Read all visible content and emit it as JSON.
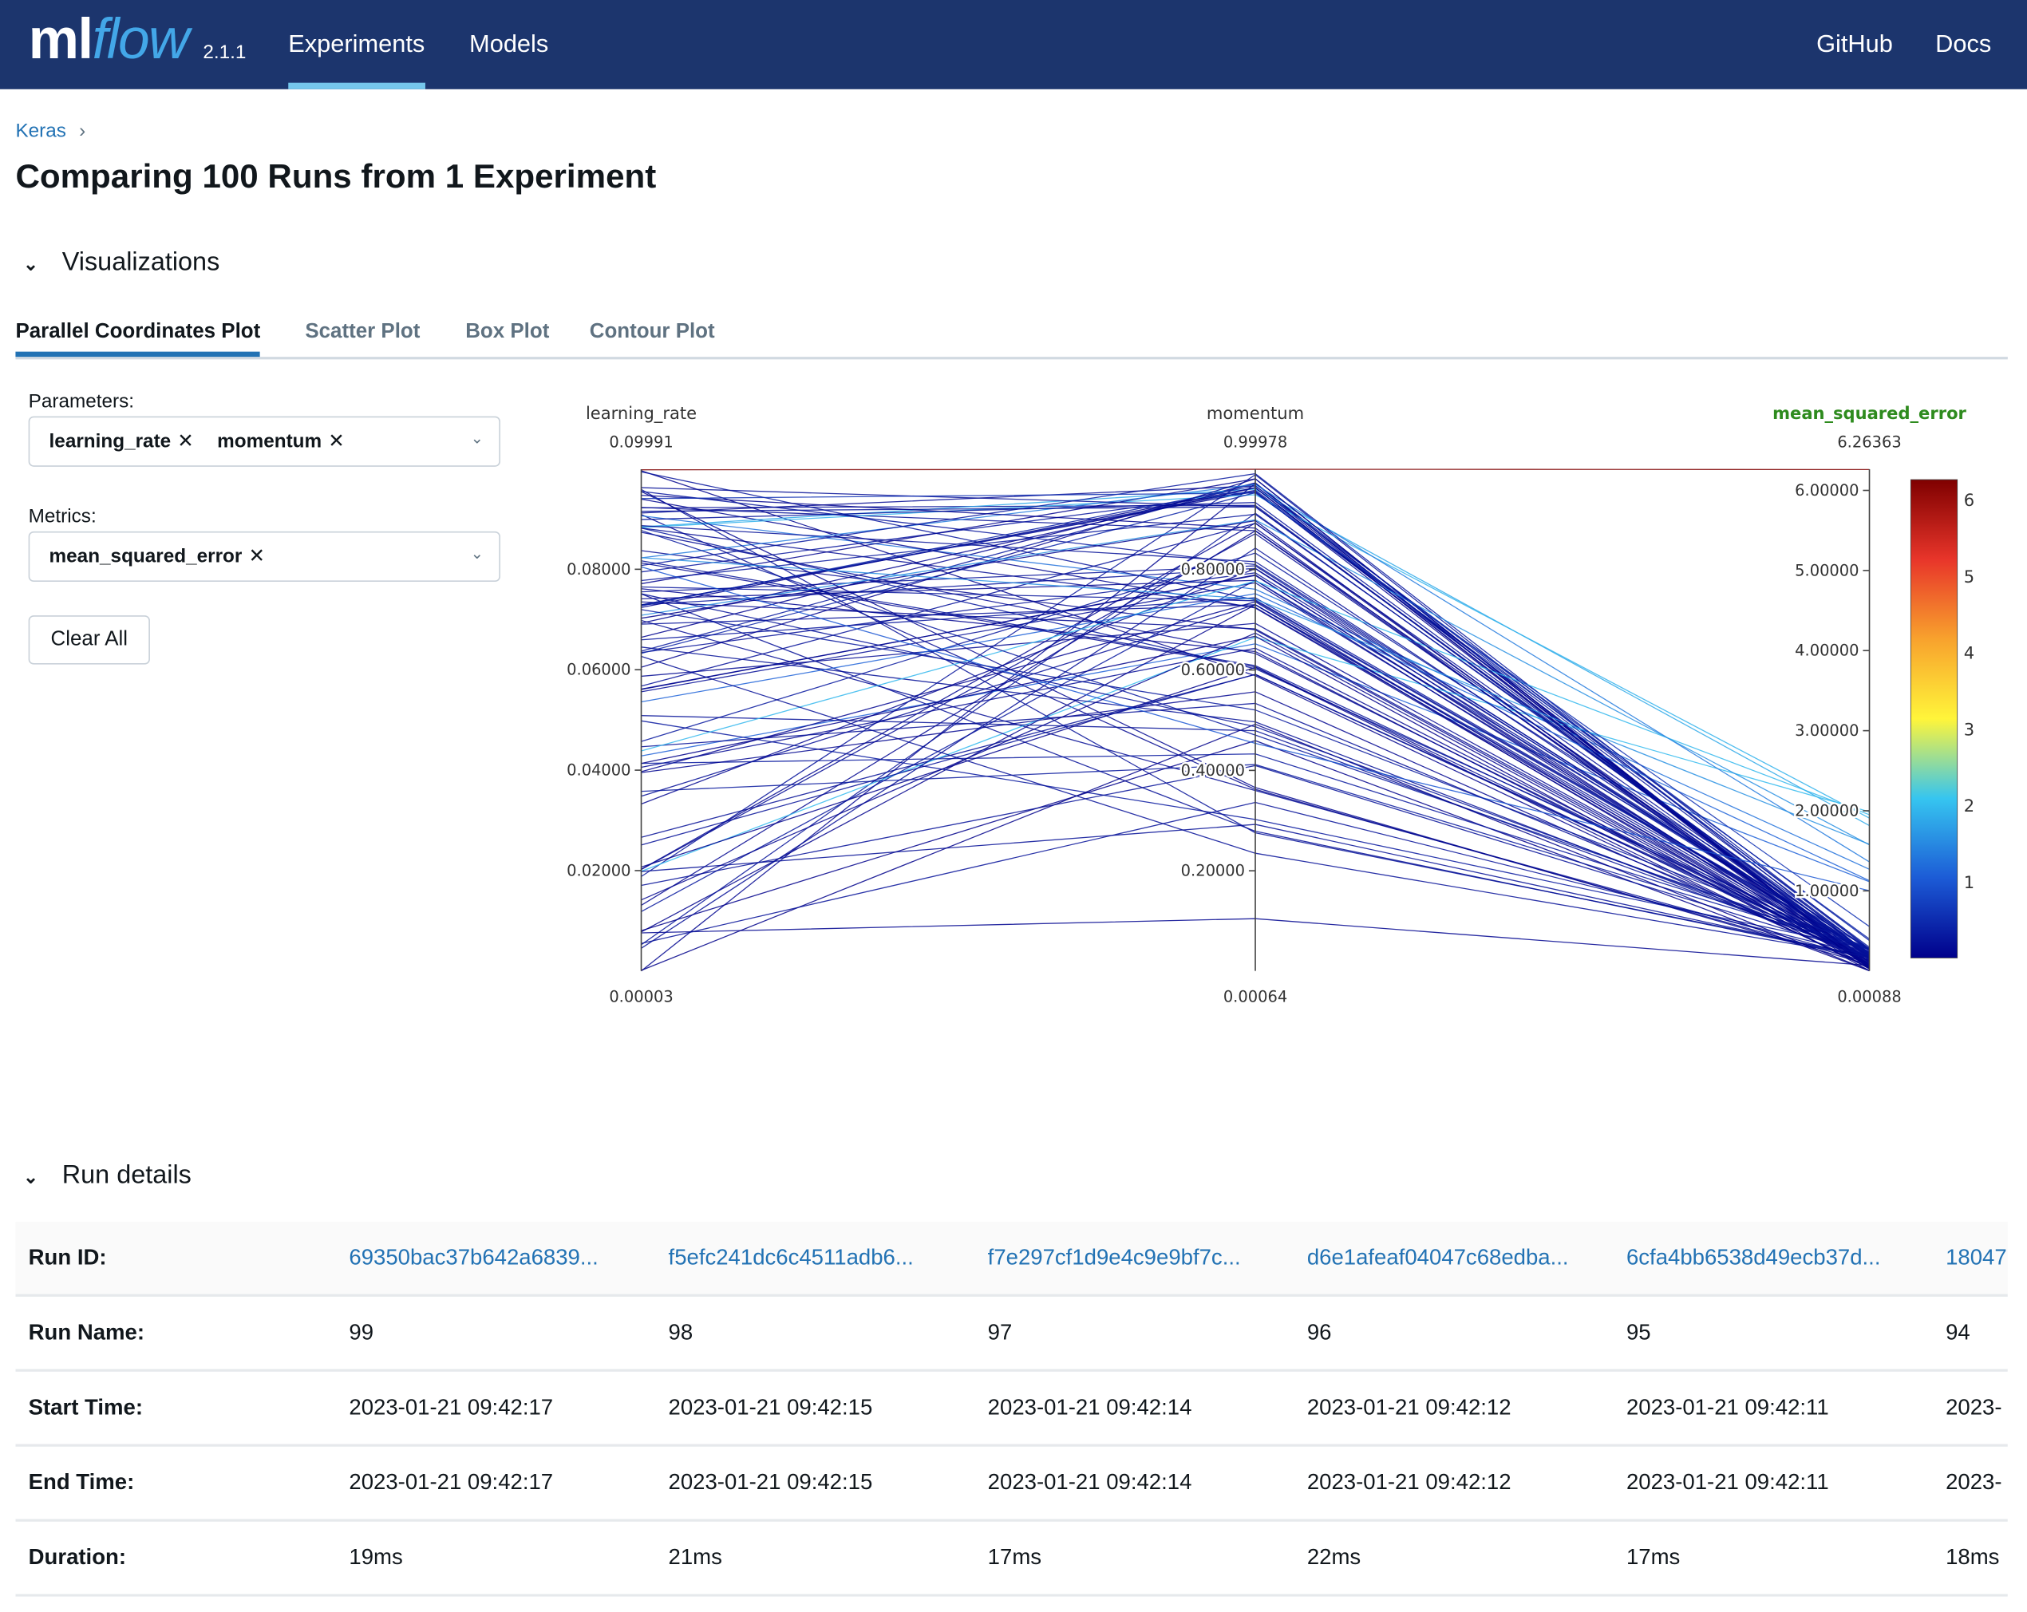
{
  "header": {
    "logo": "mlflow",
    "version": "2.1.1",
    "nav": [
      {
        "label": "Experiments",
        "active": true
      },
      {
        "label": "Models"
      }
    ],
    "right": [
      "GitHub",
      "Docs"
    ]
  },
  "breadcrumb": "Keras",
  "title": "Comparing 100 Runs from 1 Experiment",
  "visualizations": {
    "label": "Visualizations",
    "tabs": [
      "Parallel Coordinates Plot",
      "Scatter Plot",
      "Box Plot",
      "Contour Plot"
    ],
    "active_tab": "Parallel Coordinates Plot",
    "parameters_label": "Parameters:",
    "parameters": [
      "learning_rate",
      "momentum"
    ],
    "metrics_label": "Metrics:",
    "metrics": [
      "mean_squared_error"
    ],
    "clear_all": "Clear All"
  },
  "chart_data": {
    "type": "parallel_coordinates",
    "run_count": 100,
    "axes": [
      {
        "name": "learning_rate",
        "min": 3e-05,
        "max": 0.09991,
        "min_label": "0.00003",
        "max_label": "0.09991",
        "ticks": [
          "0.02000",
          "0.04000",
          "0.06000",
          "0.08000"
        ]
      },
      {
        "name": "momentum",
        "min": 0.00064,
        "max": 0.99978,
        "min_label": "0.00064",
        "max_label": "0.99978",
        "ticks": [
          "0.20000",
          "0.40000",
          "0.60000",
          "0.80000"
        ]
      },
      {
        "name": "mean_squared_error",
        "min": 0.00088,
        "max": 6.26363,
        "min_label": "0.00088",
        "max_label": "6.26363",
        "ticks": [
          "1.00000",
          "2.00000",
          "3.00000",
          "4.00000",
          "5.00000",
          "6.00000"
        ],
        "highlight_color": "#2e8b1e"
      }
    ],
    "colorscale": [
      "#00008b",
      "#1c5bd6",
      "#36c5f0",
      "#fff53a",
      "#f8a22d",
      "#e8352a",
      "#7f0000"
    ],
    "colorbar_ticks": [
      "1",
      "2",
      "3",
      "4",
      "5",
      "6"
    ]
  },
  "run_details": {
    "label": "Run details",
    "rows": [
      {
        "key": "Run ID:",
        "values": [
          "69350bac37b642a6839...",
          "f5efc241dc6c4511adb6...",
          "f7e297cf1d9e4c9e9bf7c...",
          "d6e1afeaf04047c68edba...",
          "6cfa4bb6538d49ecb37d...",
          "18047"
        ]
      },
      {
        "key": "Run Name:",
        "values": [
          "99",
          "98",
          "97",
          "96",
          "95",
          "94"
        ]
      },
      {
        "key": "Start Time:",
        "values": [
          "2023-01-21 09:42:17",
          "2023-01-21 09:42:15",
          "2023-01-21 09:42:14",
          "2023-01-21 09:42:12",
          "2023-01-21 09:42:11",
          "2023-"
        ]
      },
      {
        "key": "End Time:",
        "values": [
          "2023-01-21 09:42:17",
          "2023-01-21 09:42:15",
          "2023-01-21 09:42:14",
          "2023-01-21 09:42:12",
          "2023-01-21 09:42:11",
          "2023-"
        ]
      },
      {
        "key": "Duration:",
        "values": [
          "19ms",
          "21ms",
          "17ms",
          "22ms",
          "17ms",
          "18ms"
        ]
      }
    ]
  }
}
